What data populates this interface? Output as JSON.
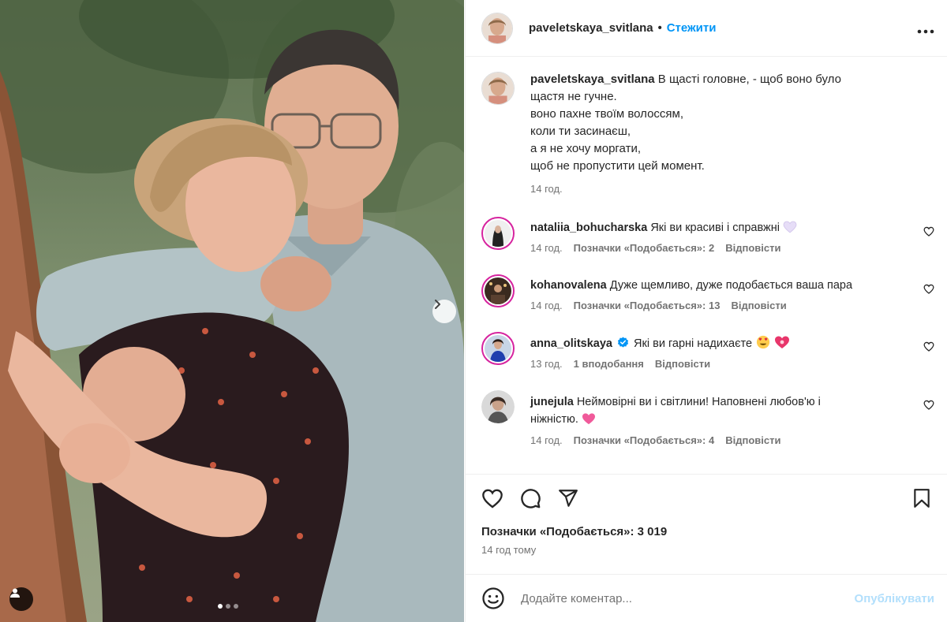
{
  "post": {
    "author": "paveletskaya_svitlana",
    "separator": "•",
    "follow_label": "Стежити",
    "more_label": "•••",
    "caption": {
      "user": "paveletskaya_svitlana",
      "lines": [
        "В щасті головне, - щоб воно було",
        "щастя не гучне.",
        "воно пахне твоїм волоссям,",
        "коли ти засинаєш,",
        "а я не хочу моргати,",
        "щоб не пропустити цей момент."
      ],
      "time": "14 год."
    }
  },
  "comments": [
    {
      "user": "nataliia_bohucharska",
      "text": "Які ви красиві і справжні",
      "emoji": "white-heart",
      "time": "14 год.",
      "likes": "Позначки «Подобається»: 2",
      "reply": "Відповісти",
      "ring": true,
      "verified": false
    },
    {
      "user": "kohanovalena",
      "text": "Дуже щемливо, дуже подобається ваша пара",
      "emoji": "",
      "time": "14 год.",
      "likes": "Позначки «Подобається»: 13",
      "reply": "Відповісти",
      "ring": true,
      "verified": false
    },
    {
      "user": "anna_olitskaya",
      "text": "Які ви гарні надихаєте",
      "emoji": "heart-eyes, heart",
      "time": "13 год.",
      "likes": "1 вподобання",
      "reply": "Відповісти",
      "ring": true,
      "verified": true
    },
    {
      "user": "junejula",
      "text_line1": "Неймовірні ви і світлини! Наповнені любов'ю і",
      "text_line2": "ніжністю.",
      "emoji": "pink-heart",
      "time": "14 год.",
      "likes": "Позначки «Подобається»: 4",
      "reply": "Відповісти",
      "ring": false,
      "verified": false
    }
  ],
  "actions": {
    "likes_label": "Позначки «Подобається»: 3 019",
    "posted": "14 год тому"
  },
  "composer": {
    "placeholder": "Додайте коментар...",
    "publish_label": "Опублікувати"
  },
  "colors": {
    "accent": "#0095f6",
    "publish_disabled": "#b2dffc",
    "muted_text": "#737373",
    "story_ring": "#d6249f"
  },
  "carousel": {
    "current": 1,
    "total": 3
  }
}
